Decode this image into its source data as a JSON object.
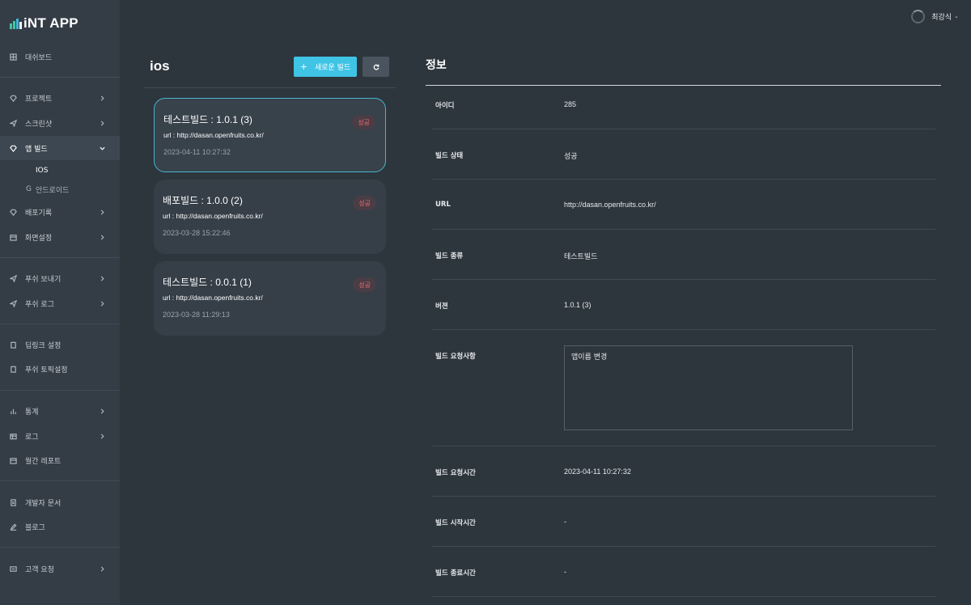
{
  "app": {
    "logo_text": "iNT APP"
  },
  "user": {
    "name": "최강식",
    "caret": "⌄"
  },
  "sidebar": {
    "items": [
      {
        "label": "대쉬보드",
        "icon": "dashboard-icon"
      },
      {
        "label": "프로젝트",
        "icon": "diamond-icon"
      },
      {
        "label": "스크린샷",
        "icon": "send-icon"
      },
      {
        "label": "앱 빌드",
        "icon": "diamond-icon"
      },
      {
        "label": "배포기록",
        "icon": "diamond-icon"
      },
      {
        "label": "화면설정",
        "icon": "calendar-icon"
      },
      {
        "label": "푸쉬 보내기",
        "icon": "send-icon"
      },
      {
        "label": "푸쉬 로그",
        "icon": "send-icon"
      },
      {
        "label": "딥링크 설정",
        "icon": "clipboard-icon"
      },
      {
        "label": "푸쉬 토픽설정",
        "icon": "clipboard-icon"
      },
      {
        "label": "통계",
        "icon": "bar-chart-icon"
      },
      {
        "label": "로그",
        "icon": "table-icon"
      },
      {
        "label": "월간 레포트",
        "icon": "calendar-icon"
      },
      {
        "label": "개발자 문서",
        "icon": "document-icon"
      },
      {
        "label": "블로그",
        "icon": "pen-icon"
      },
      {
        "label": "고객 요청",
        "icon": "message-icon"
      }
    ],
    "sub_items": [
      {
        "label": "IOS",
        "glyph": ""
      },
      {
        "label": "안드로이드",
        "glyph": "G"
      }
    ]
  },
  "builds": {
    "title": "ios",
    "new_button_plus": "+",
    "new_button_label": "새로운 빌드",
    "cards": [
      {
        "title": "테스트빌드 : 1.0.1 (3)",
        "url": "url : http://dasan.openfruits.co.kr/",
        "date": "2023-04-11 10:27:32",
        "status": "성공"
      },
      {
        "title": "배포빌드 : 1.0.0 (2)",
        "url": "url : http://dasan.openfruits.co.kr/",
        "date": "2023-03-28 15:22:46",
        "status": "성공"
      },
      {
        "title": "테스트빌드 : 0.0.1 (1)",
        "url": "url : http://dasan.openfruits.co.kr/",
        "date": "2023-03-28 11:29:13",
        "status": "성공"
      }
    ]
  },
  "info": {
    "title": "정보",
    "rows": [
      {
        "label": "아이디",
        "value": "285"
      },
      {
        "label": "빌드 상태",
        "value": "성공"
      },
      {
        "label": "URL",
        "value": "http://dasan.openfruits.co.kr/"
      },
      {
        "label": "빌드 종류",
        "value": "테스트빌드"
      },
      {
        "label": "버젼",
        "value": "1.0.1 (3)"
      },
      {
        "label": "빌드 요청사항",
        "value": "앱이름 변경"
      },
      {
        "label": "빌드 요청시간",
        "value": "2023-04-11 10:27:32"
      },
      {
        "label": "빌드 시작시간",
        "value": "-"
      },
      {
        "label": "빌드 종료시간",
        "value": "-"
      }
    ]
  },
  "colors": {
    "accent": "#3fc4e5",
    "success_badge": "#ef6a73",
    "sidebar_bg": "#343d46",
    "page_bg": "#2d353d"
  }
}
